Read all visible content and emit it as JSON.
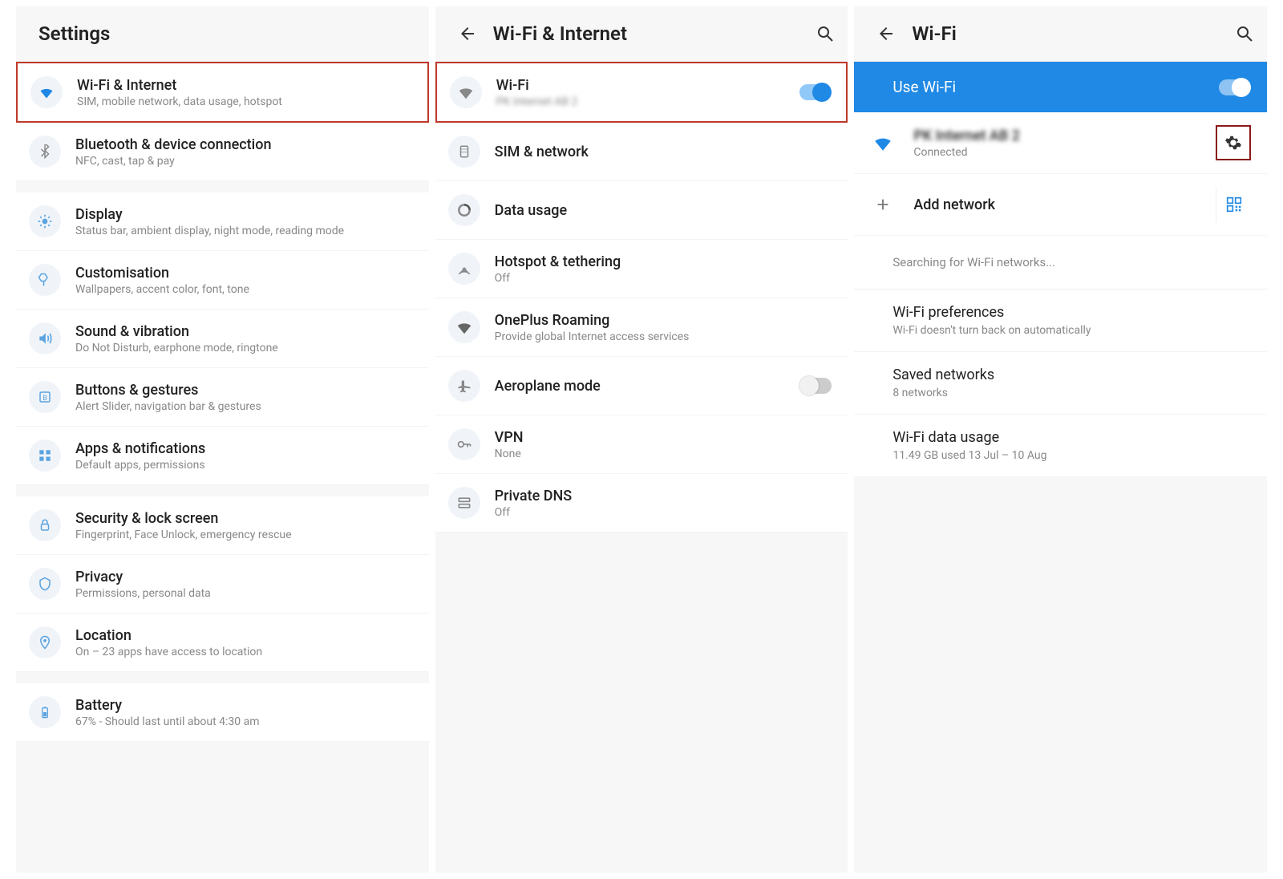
{
  "panel1": {
    "title": "Settings",
    "items": [
      {
        "name": "wifi-internet",
        "label": "Wi-Fi & Internet",
        "sub": "SIM, mobile network, data usage, hotspot",
        "highlight": true
      },
      {
        "name": "bluetooth",
        "label": "Bluetooth & device connection",
        "sub": "NFC, cast, tap & pay"
      },
      {
        "gap": true
      },
      {
        "name": "display",
        "label": "Display",
        "sub": "Status bar, ambient display, night mode, reading mode"
      },
      {
        "name": "customisation",
        "label": "Customisation",
        "sub": "Wallpapers, accent color, font, tone"
      },
      {
        "name": "sound",
        "label": "Sound & vibration",
        "sub": "Do Not Disturb, earphone mode, ringtone"
      },
      {
        "name": "buttons",
        "label": "Buttons & gestures",
        "sub": "Alert Slider, navigation bar & gestures"
      },
      {
        "name": "apps",
        "label": "Apps & notifications",
        "sub": "Default apps, permissions"
      },
      {
        "gap": true
      },
      {
        "name": "security",
        "label": "Security & lock screen",
        "sub": "Fingerprint, Face Unlock, emergency rescue"
      },
      {
        "name": "privacy",
        "label": "Privacy",
        "sub": "Permissions, personal data"
      },
      {
        "name": "location",
        "label": "Location",
        "sub": "On – 23 apps have access to location"
      },
      {
        "gap": true
      },
      {
        "name": "battery",
        "label": "Battery",
        "sub": "67% - Should last until about 4:30 am"
      }
    ]
  },
  "panel2": {
    "title": "Wi-Fi & Internet",
    "items": [
      {
        "name": "wifi",
        "label": "Wi-Fi",
        "sub_blur": "PK Internet AB 2",
        "switch": "on",
        "highlight": true
      },
      {
        "name": "sim-network",
        "label": "SIM & network"
      },
      {
        "name": "data-usage",
        "label": "Data usage"
      },
      {
        "name": "hotspot",
        "label": "Hotspot & tethering",
        "sub": "Off"
      },
      {
        "name": "roaming",
        "label": "OnePlus Roaming",
        "sub": "Provide global Internet access services"
      },
      {
        "name": "aeroplane",
        "label": "Aeroplane mode",
        "switch": "off"
      },
      {
        "name": "vpn",
        "label": "VPN",
        "sub": "None"
      },
      {
        "name": "private-dns",
        "label": "Private DNS",
        "sub": "Off"
      }
    ]
  },
  "panel3": {
    "title": "Wi-Fi",
    "use_wifi_label": "Use Wi-Fi",
    "connected": {
      "name_blur": "PK Internet AB 2",
      "status": "Connected"
    },
    "add_network_label": "Add network",
    "searching_text": "Searching for Wi-Fi networks...",
    "preferences": {
      "label": "Wi-Fi preferences",
      "sub": "Wi-Fi doesn't turn back on automatically"
    },
    "saved": {
      "label": "Saved networks",
      "sub": "8 networks"
    },
    "usage": {
      "label": "Wi-Fi data usage",
      "sub": "11.49 GB used 13 Jul – 10 Aug"
    }
  }
}
